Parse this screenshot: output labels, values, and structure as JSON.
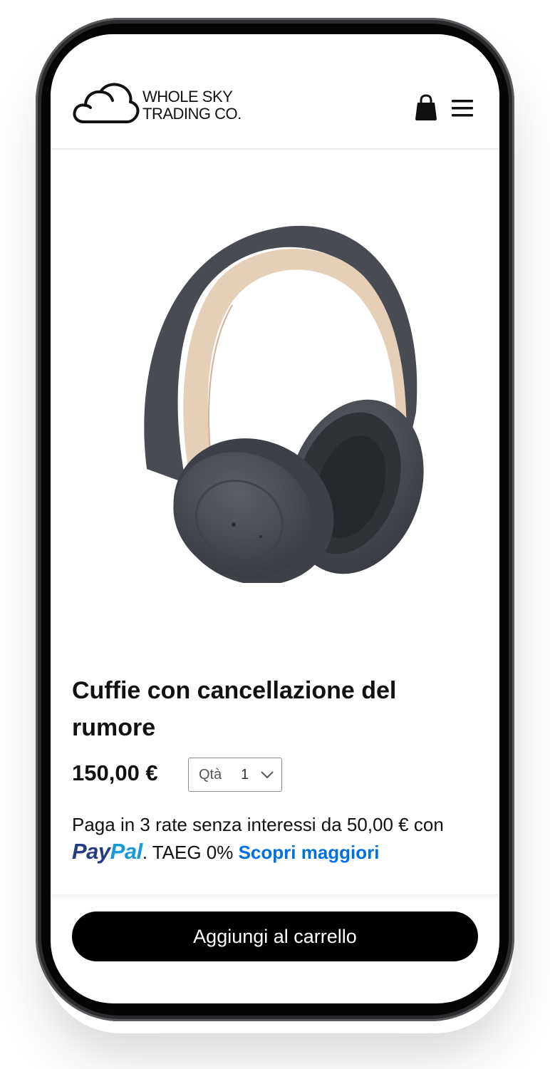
{
  "header": {
    "logo_line1": "WHOLE SKY",
    "logo_line2": "TRADING CO.",
    "cart_icon": "shopping-bag-icon",
    "menu_icon": "hamburger-menu-icon"
  },
  "product": {
    "image": "noise-cancelling-headphones",
    "title": "Cuffie con cancellazione del rumore",
    "price": "150,00 €",
    "quantity": {
      "label": "Qtà",
      "value": "1"
    }
  },
  "paypal": {
    "text_before": "Paga in 3 rate senza interessi da 50,00 € con ",
    "brand_part1": "Pay",
    "brand_part2": "Pal",
    "text_after": ". TAEG 0% ",
    "learn_more": "Scopri maggiori"
  },
  "cart_button_label": "Aggiungi al carrello",
  "colors": {
    "button": "#000000",
    "link": "#0070e0",
    "paypal_dark": "#253b80",
    "paypal_light": "#179bd7"
  }
}
